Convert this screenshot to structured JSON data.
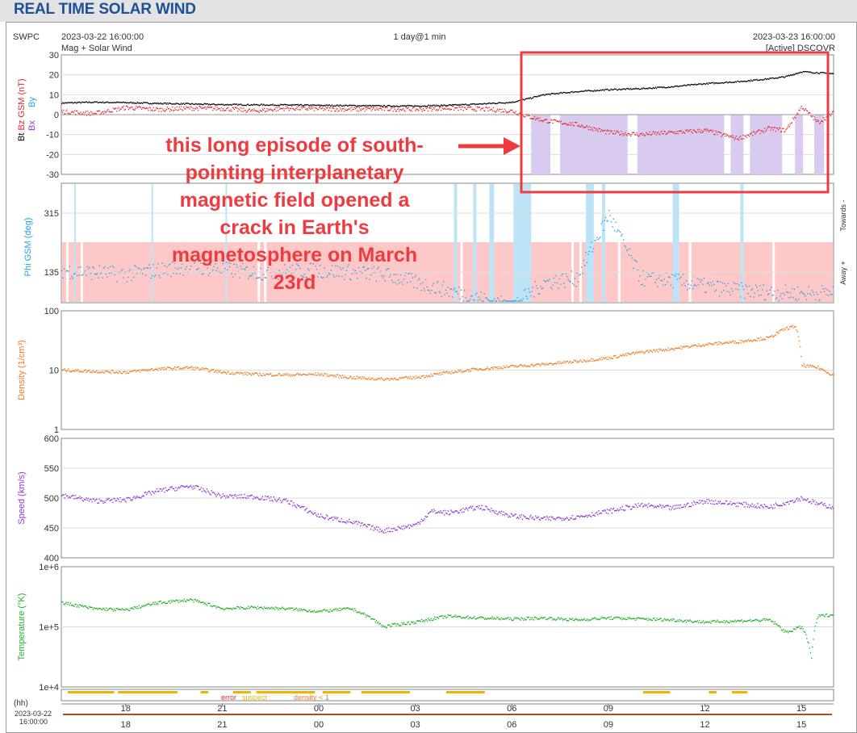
{
  "header": {
    "title": "REAL TIME SOLAR WIND"
  },
  "info": {
    "org": "SWPC",
    "start": "2023-03-22 16:00:00",
    "product": "Mag + Solar Wind",
    "span": "1 day@1 min",
    "end": "2023-03-23 16:00:00",
    "source": "[Active] DSCOVR"
  },
  "annotation": {
    "lines": [
      "this long episode of south-",
      "pointing interplanetary",
      "magnetic field opened a",
      "crack in Earth's",
      "magnetosphere on March",
      "23rd"
    ],
    "color": "#ee3b40"
  },
  "status": {
    "error": "error",
    "suspect": "suspect",
    "density": "density < 1"
  },
  "time_axis": {
    "hh_label": "(hh)",
    "date_line1": "2023-03-22",
    "date_line2": "16:00:00",
    "ticks": [
      "18",
      "21",
      "00",
      "03",
      "06",
      "09",
      "12",
      "15"
    ]
  },
  "chart_data": [
    {
      "type": "line",
      "panel": "mag",
      "ylabel_parts": {
        "bt": "Bt",
        "bz": "Bz GSM (nT)",
        "bx": "Bx",
        "by": "By"
      },
      "ylim": [
        -30,
        30
      ],
      "yticks": [
        "30",
        "20",
        "10",
        "0",
        "-10",
        "-20",
        "-30"
      ],
      "x_hours": [
        0,
        1,
        2,
        3,
        4,
        5,
        6,
        7,
        8,
        9,
        10,
        11,
        12,
        13,
        14,
        14.5,
        15,
        16,
        17,
        18,
        19,
        20,
        21,
        22,
        22.5,
        23,
        23.5,
        24
      ],
      "series": [
        {
          "name": "Bt",
          "color": "#000000",
          "values": [
            5.8,
            6.2,
            6.0,
            5.6,
            5.3,
            5.0,
            4.9,
            4.8,
            4.6,
            4.5,
            4.3,
            4.3,
            4.6,
            5.3,
            6.2,
            8,
            10,
            11.5,
            12.5,
            13,
            14,
            15.5,
            16.5,
            18,
            19,
            21.5,
            21,
            20.5
          ]
        },
        {
          "name": "Bz GSM",
          "color": "#e0262c",
          "values": [
            1.5,
            0.5,
            3.5,
            2.5,
            3.2,
            3.0,
            1.8,
            3.2,
            2.8,
            2.6,
            2.8,
            2.6,
            3.2,
            2.8,
            1.8,
            -1,
            -3,
            -5,
            -9,
            -10,
            -9,
            -8,
            -12,
            -7,
            -8,
            4,
            -4,
            1
          ]
        }
      ],
      "southward_periods_h": [
        [
          14.6,
          15.2
        ],
        [
          15.5,
          17.6
        ],
        [
          17.9,
          20.6
        ],
        [
          20.8,
          21.2
        ],
        [
          21.4,
          22.4
        ],
        [
          22.8,
          23.05
        ],
        [
          23.4,
          23.7
        ]
      ],
      "southward_color": "#d8cbef"
    },
    {
      "type": "scatter",
      "panel": "phi",
      "ylabel": "Phi GSM (deg)",
      "yticks": [
        "315",
        "135"
      ],
      "side_labels": [
        "Towards -",
        "Away +"
      ],
      "away_color": "#ffc8c8",
      "towards_color": "#bde4f6",
      "towards_periods_h": [
        [
          0.4,
          0.45
        ],
        [
          2.8,
          2.85
        ],
        [
          5.1,
          5.15
        ],
        [
          12.2,
          12.3
        ],
        [
          12.8,
          12.9
        ],
        [
          13.3,
          13.45
        ],
        [
          14.05,
          14.6
        ],
        [
          16.3,
          16.55
        ],
        [
          16.8,
          16.9
        ],
        [
          19.0,
          19.2
        ],
        [
          21.1,
          21.2
        ]
      ],
      "series": [
        {
          "name": "Phi",
          "color": "#29a3df",
          "x_hours": [
            0,
            2,
            4,
            6,
            8,
            10,
            12,
            13,
            14,
            15,
            16,
            17,
            18,
            19,
            20,
            21,
            22,
            23,
            24
          ],
          "values": [
            150,
            140,
            160,
            145,
            150,
            140,
            100,
            80,
            60,
            120,
            130,
            290,
            130,
            125,
            110,
            100,
            95,
            92,
            95
          ]
        }
      ]
    },
    {
      "type": "scatter",
      "panel": "density",
      "ylabel": "Density (1/cm³)",
      "yscale": "log",
      "ylim": [
        1,
        100
      ],
      "yticks": [
        "100",
        "10",
        "1"
      ],
      "series": [
        {
          "name": "Density",
          "color": "#f07a22",
          "x_hours": [
            0,
            1,
            2,
            3,
            4,
            5,
            6,
            7,
            8,
            9,
            10,
            11,
            12,
            13,
            14,
            15,
            16,
            17,
            18,
            19,
            20,
            21,
            22,
            22.5,
            22.8,
            23,
            23.5,
            24
          ],
          "values": [
            10,
            9.5,
            9.2,
            10.5,
            11,
            9.2,
            8.5,
            8.3,
            8.5,
            7.5,
            7,
            7.5,
            9,
            10.5,
            11.5,
            12.5,
            14,
            16,
            20,
            23,
            27,
            30,
            35,
            50,
            55,
            12,
            11,
            8
          ]
        }
      ]
    },
    {
      "type": "scatter",
      "panel": "speed",
      "ylabel": "Speed (km/s)",
      "ylim": [
        400,
        600
      ],
      "yticks": [
        "600",
        "550",
        "500",
        "450",
        "400"
      ],
      "series": [
        {
          "name": "Speed",
          "color": "#9335d6",
          "x_hours": [
            0,
            1,
            2,
            3,
            4,
            5,
            6,
            7,
            8,
            9,
            10,
            11,
            11.5,
            12,
            13,
            14,
            15,
            16,
            17,
            18,
            19,
            20,
            21,
            22,
            23,
            23.5,
            24
          ],
          "values": [
            505,
            495,
            497,
            512,
            520,
            503,
            502,
            495,
            470,
            460,
            445,
            455,
            478,
            475,
            485,
            470,
            465,
            468,
            478,
            488,
            483,
            495,
            490,
            485,
            500,
            490,
            485
          ]
        }
      ]
    },
    {
      "type": "scatter",
      "panel": "temperature",
      "ylabel": "Temperature (°K)",
      "yscale": "log",
      "ylim": [
        10000,
        1000000
      ],
      "yticks": [
        "1e+6",
        "1e+5",
        "1e+4"
      ],
      "series": [
        {
          "name": "Temperature",
          "color": "#22b02a",
          "x_hours": [
            0,
            1,
            2,
            3,
            4,
            5,
            6,
            7,
            8,
            9,
            10,
            11,
            12,
            13,
            14,
            15,
            16,
            17,
            18,
            19,
            20,
            21,
            22,
            22.5,
            23,
            23.3,
            23.5,
            24
          ],
          "values": [
            250000,
            200000,
            190000,
            250000,
            280000,
            200000,
            210000,
            200000,
            180000,
            200000,
            100000,
            120000,
            150000,
            140000,
            135000,
            140000,
            130000,
            140000,
            135000,
            130000,
            120000,
            125000,
            130000,
            80000,
            100000,
            30000,
            150000,
            160000
          ]
        }
      ]
    }
  ]
}
